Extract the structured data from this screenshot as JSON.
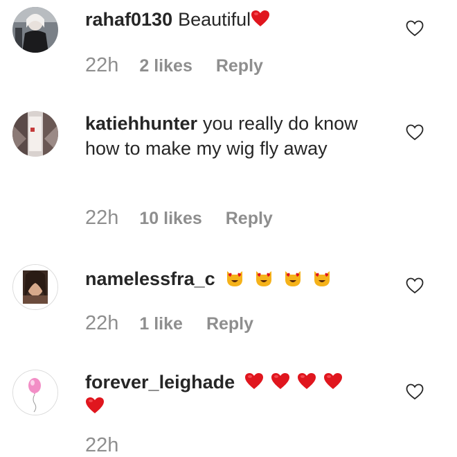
{
  "comments": [
    {
      "username": "rahaf0130",
      "text": "Beautiful",
      "emoji": [
        "red-heart"
      ],
      "time": "22h",
      "likes": "2 likes",
      "reply": "Reply"
    },
    {
      "username": "katiehhunter",
      "text": "you really do know how to make my wig fly away",
      "emoji": [],
      "time": "22h",
      "likes": "10 likes",
      "reply": "Reply"
    },
    {
      "username": "namelessfra_c",
      "text": "",
      "emoji": [
        "heart-eyes-cat",
        "heart-eyes-cat",
        "heart-eyes-cat",
        "heart-eyes-cat"
      ],
      "time": "22h",
      "likes": "1 like",
      "reply": "Reply"
    },
    {
      "username": "forever_leighade",
      "text": "",
      "emoji": [
        "red-heart",
        "red-heart",
        "red-heart",
        "red-heart",
        "red-heart"
      ],
      "time": "22h",
      "likes": "",
      "reply": ""
    }
  ],
  "icons": {
    "like": "heart-outline-icon",
    "heart_color": "#e0161e",
    "cat_color": "#f5b21a"
  }
}
